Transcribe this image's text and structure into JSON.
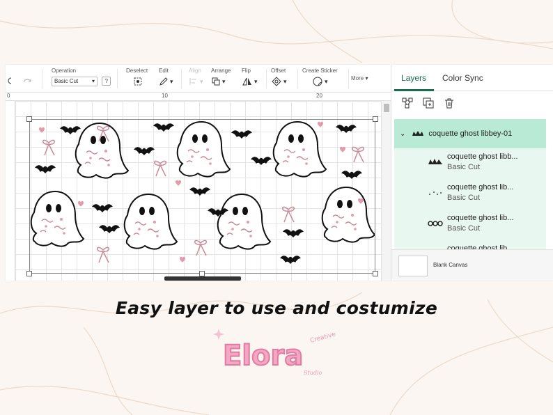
{
  "toolbar": {
    "operation_label": "Operation",
    "operation_value": "Basic Cut",
    "help_label": "?",
    "deselect_label": "Deselect",
    "edit_label": "Edit",
    "align_label": "Align",
    "arrange_label": "Arrange",
    "flip_label": "Flip",
    "offset_label": "Offset",
    "create_sticker_label": "Create Sticker",
    "more_label": "More"
  },
  "ruler": {
    "marks": [
      "0",
      "10",
      "20"
    ]
  },
  "panel": {
    "tabs": [
      "Layers",
      "Color Sync"
    ],
    "active_tab": "Layers",
    "group": {
      "name": "coquette ghost libbey-01"
    },
    "layers": [
      {
        "name": "coquette ghost libb...",
        "operation": "Basic Cut"
      },
      {
        "name": "coquette ghost lib...",
        "operation": "Basic Cut"
      },
      {
        "name": "coquette ghost lib...",
        "operation": "Basic Cut"
      },
      {
        "name": "coquette ghost lib...",
        "operation": ""
      }
    ],
    "blank_canvas_label": "Blank Canvas"
  },
  "caption": "Easy layer to use and costumize",
  "logo": {
    "main": "Elora",
    "sub": "Creative",
    "tag": "Studio"
  },
  "colors": {
    "accent": "#1a6b4f",
    "group_bg": "#b8ead5",
    "list_bg": "#e8f7f0",
    "pink": "#d68a9c"
  }
}
